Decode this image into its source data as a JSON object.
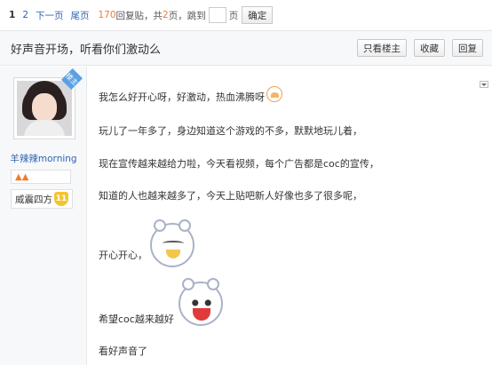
{
  "pager": {
    "current_page": "1",
    "page2": "2",
    "next": "下一页",
    "last": "尾页",
    "reply_count": "170",
    "reply_label": "回复贴，共",
    "pages_count": "2",
    "pages_label": "页，跳到",
    "page_unit": "页",
    "ok": "确定"
  },
  "thread": {
    "title": "好声音开场，听看你们激动么",
    "btn_only_owner": "只看楼主",
    "btn_favorite": "收藏",
    "btn_reply": "回复"
  },
  "author": {
    "badge": "楼主",
    "name": "羊辣辣morning",
    "rank": "威震四方",
    "level": "11"
  },
  "post": {
    "line1": "我怎么好开心呀，好激动，热血沸腾呀",
    "line2": "玩儿了一年多了，身边知道这个游戏的不多，默默地玩儿着，",
    "line3": "现在宣传越来越给力啦，今天看视频，每个广告都是coc的宣传，",
    "line4": "知道的人也越来越多了，今天上贴吧新人好像也多了很多呢，",
    "line5": "开心开心，",
    "line6": "希望coc越来越好",
    "line7": "看好声音了"
  },
  "colors": {
    "link": "#2d64b3",
    "accent": "#f27b30"
  }
}
